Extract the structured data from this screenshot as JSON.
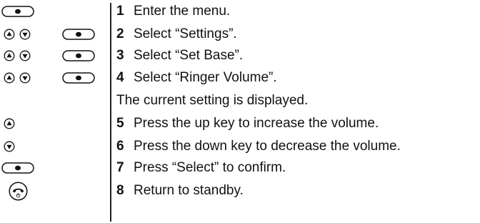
{
  "steps": [
    {
      "number": "1",
      "text": "Enter the menu."
    },
    {
      "number": "2",
      "text": "Select “Settings”."
    },
    {
      "number": "3",
      "text": "Select “Set Base”."
    },
    {
      "number": "4",
      "text": "Select “Ringer Volume”."
    },
    {
      "number": "5",
      "text": "Press the up key to increase the volume."
    },
    {
      "number": "6",
      "text": "Press the down key to decrease the volume."
    },
    {
      "number": "7",
      "text": "Press “Select” to confirm."
    },
    {
      "number": "8",
      "text": "Return to standby."
    }
  ],
  "note": "The current setting is displayed.",
  "icons": [
    [
      "select-key-icon"
    ],
    [
      "up-key-icon",
      "down-key-icon",
      "select-key-icon"
    ],
    [
      "up-key-icon",
      "down-key-icon",
      "select-key-icon"
    ],
    [
      "up-key-icon",
      "down-key-icon",
      "select-key-icon"
    ],
    [],
    [
      "up-key-icon"
    ],
    [
      "down-key-icon"
    ],
    [
      "select-key-icon"
    ],
    [
      "end-call-key-icon"
    ]
  ]
}
